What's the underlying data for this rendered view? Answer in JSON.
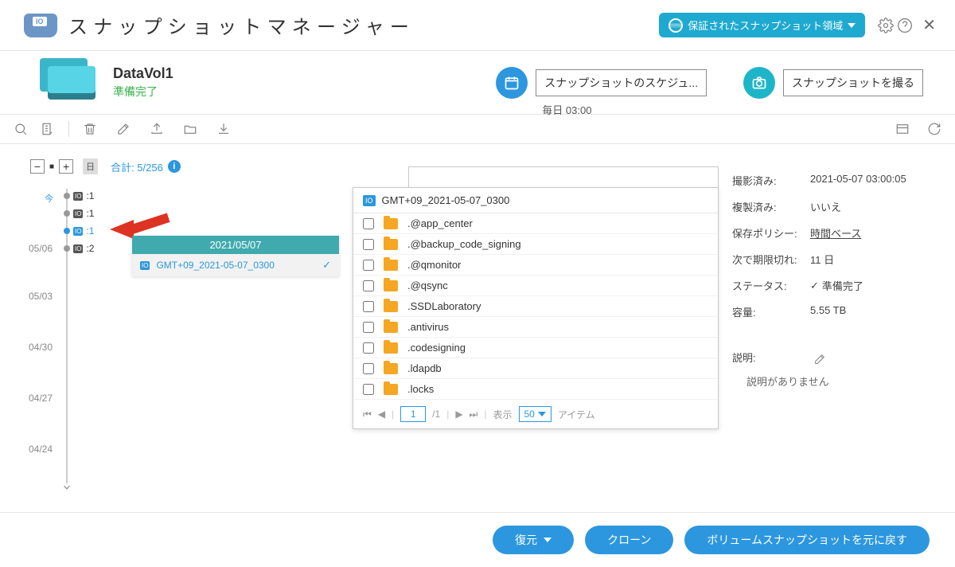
{
  "title": "スナップショットマネージャー",
  "header_button": "保証されたスナップショット領域",
  "volume": {
    "name": "DataVol1",
    "status": "準備完了"
  },
  "schedule": {
    "label": "スナップショットのスケジュ...",
    "sub": "毎日 03:00"
  },
  "take_snapshot": "スナップショットを撮る",
  "total_label": "合計: 5/256",
  "timeline": {
    "now_label": "今",
    "day_icon": "日",
    "dates": [
      "05/06",
      "05/03",
      "04/30",
      "04/27",
      "04/24"
    ],
    "entries": [
      {
        "count": ":1",
        "active": false
      },
      {
        "count": ":1",
        "active": false
      },
      {
        "count": ":1",
        "active": true
      },
      {
        "count": ":2",
        "active": false
      }
    ],
    "popup_date": "2021/05/07",
    "popup_name": "GMT+09_2021-05-07_0300"
  },
  "crumb": "GMT+09_2021-05-07_0300",
  "folders": [
    ".@app_center",
    ".@backup_code_signing",
    ".@qmonitor",
    ".@qsync",
    ".SSDLaboratory",
    ".antivirus",
    ".codesigning",
    ".ldapdb",
    ".locks"
  ],
  "pager": {
    "page": "1",
    "pages": "/1",
    "show_label": "表示",
    "per_page": "50",
    "items_label": "アイテム"
  },
  "details": {
    "taken_k": "撮影済み:",
    "taken_v": "2021-05-07 03:00:05",
    "replicated_k": "複製済み:",
    "replicated_v": "いいえ",
    "policy_k": "保存ポリシー:",
    "policy_v": "時間ベース",
    "expire_k": "次で期限切れ:",
    "expire_v": "11 日",
    "status_k": "ステータス:",
    "status_v": "準備完了",
    "size_k": "容量:",
    "size_v": "5.55 TB",
    "desc_k": "説明:",
    "desc_v": "説明がありません"
  },
  "footer": {
    "restore": "復元",
    "clone": "クローン",
    "revert": "ボリュームスナップショットを元に戻す"
  }
}
